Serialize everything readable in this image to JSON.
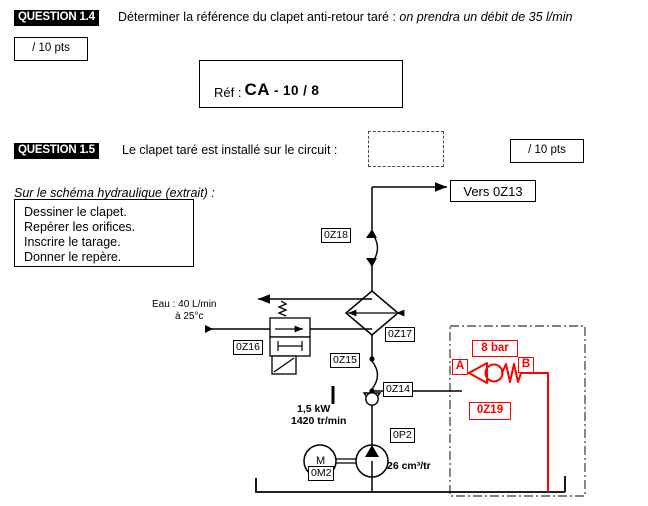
{
  "question_1_4": {
    "tag": "QUESTION 1.4",
    "prompt_plain": "Déterminer la référence du clapet anti-retour taré : ",
    "prompt_italic": "on prendra un débit de 35 l/min",
    "points": "/ 10 pts",
    "answer_box": {
      "label": "Réf :",
      "value_main": "CA",
      "value_dash": "-",
      "value_num1": "10",
      "value_slash": "/",
      "value_num2": "8"
    }
  },
  "question_1_5": {
    "tag": "QUESTION 1.5",
    "prompt": "Le clapet taré est installé sur le circuit :",
    "answer_blank": "",
    "points": "/ 10 pts",
    "subtitle": "Sur le schéma hydraulique (extrait) :",
    "instructions": [
      "Dessiner le clapet.",
      "Repérer les orifices.",
      "Inscrire le tarage.",
      "Donner le repère."
    ]
  },
  "schematic": {
    "vers_label": "Vers 0Z13",
    "components": {
      "hose_top": "0Z18",
      "heat_exchanger": "0Z17",
      "valve_2pos": "0Z16",
      "hose_lower": "0Z15",
      "check_valve": "0Z14",
      "pump": "0P2",
      "motor_symbol": "M",
      "motor": "0M2"
    },
    "annotations": {
      "water_line1": "Eau : 40 L/min",
      "water_line2": "à 25°c",
      "power_line1": "1,5 kW",
      "power_line2": "1420 tr/min",
      "displacement": "26 cm³/tr"
    },
    "red_answer": {
      "pressure": "8 bar",
      "port_a": "A",
      "port_b": "B",
      "reference": "0Z19",
      "color": "#ff0000"
    }
  }
}
